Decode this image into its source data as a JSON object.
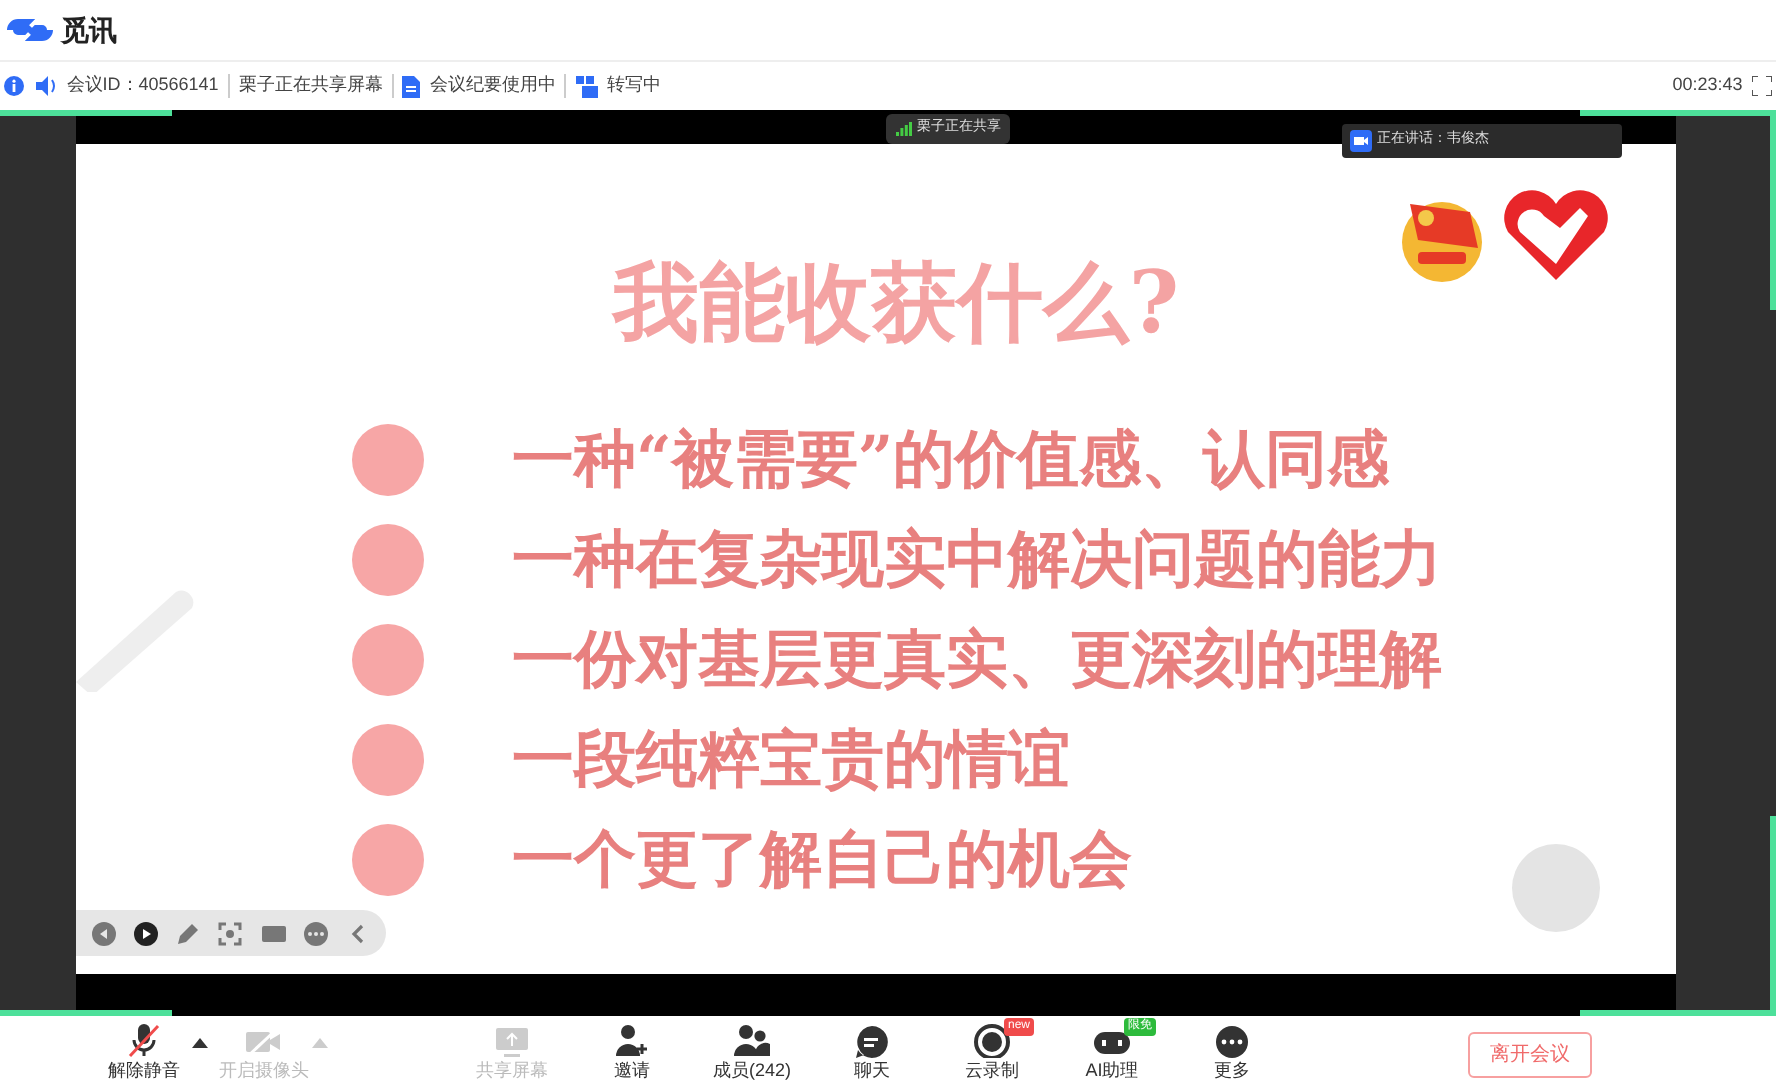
{
  "app": {
    "name": "觅讯"
  },
  "info_bar": {
    "meeting_id": "会议ID：40566141",
    "sharing": "栗子正在共享屏幕",
    "minutes": "会议纪要使用中",
    "transcribing": "转写中",
    "elapsed": "00:23:43"
  },
  "share_banner": "栗子正在共享",
  "speaker": "正在讲话：韦俊杰",
  "slide": {
    "title": "我能收获什么?",
    "items": [
      "一种“被需要”的价值感、认同感",
      "一种在复杂现实中解决问题的能力",
      "一份对基层更真实、更深刻的理解",
      "一段纯粹宝贵的情谊",
      "一个更了解自己的机会"
    ]
  },
  "toolbar": [
    {
      "kind": "mic",
      "label": "解除静音",
      "disabled": false,
      "muted": true,
      "menu": true
    },
    {
      "kind": "camera",
      "label": "开启摄像头",
      "disabled": true,
      "muted": true,
      "menu": true
    },
    {
      "kind": "share",
      "label": "共享屏幕",
      "disabled": true
    },
    {
      "kind": "invite",
      "label": "邀请",
      "disabled": false
    },
    {
      "kind": "members",
      "label": "成员(242)",
      "disabled": false
    },
    {
      "kind": "chat",
      "label": "聊天",
      "disabled": false
    },
    {
      "kind": "record",
      "label": "云录制",
      "disabled": false,
      "badge": "new"
    },
    {
      "kind": "ai",
      "label": "AI助理",
      "disabled": false,
      "badge": "限免"
    },
    {
      "kind": "more",
      "label": "更多",
      "disabled": false
    }
  ],
  "leave_button": "离开会议"
}
